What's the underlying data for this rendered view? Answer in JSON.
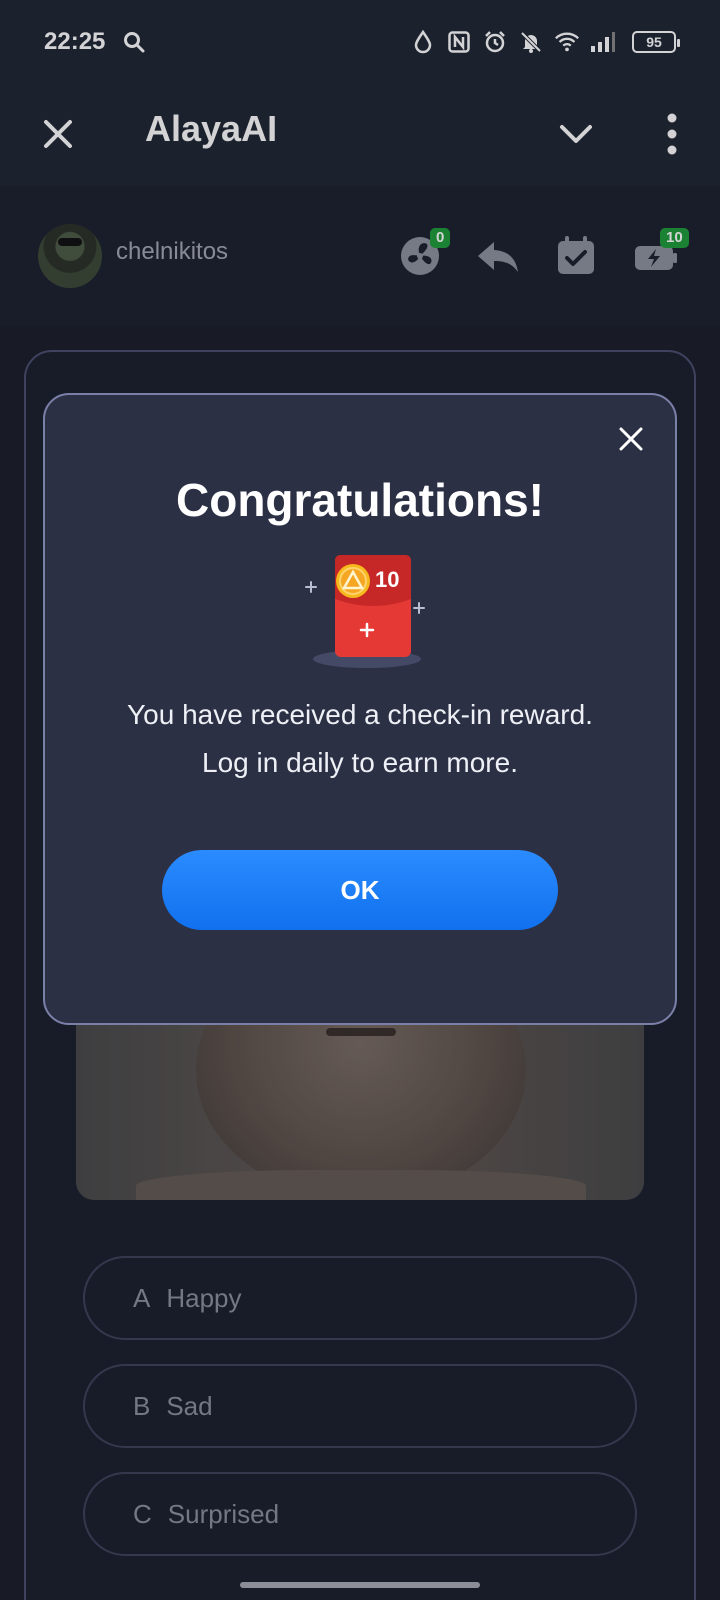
{
  "status_bar": {
    "time": "22:25",
    "battery": "95",
    "icons": [
      "search-icon",
      "water-drop-icon",
      "nfc-icon",
      "alarm-icon",
      "bell-off-icon",
      "wifi-icon",
      "signal-icon",
      "battery-icon"
    ]
  },
  "app_bar": {
    "title": "AlayaAI",
    "icons": [
      "close-icon",
      "chevron-down-icon",
      "more-vert-icon"
    ]
  },
  "user": {
    "name": "chelnikitos",
    "fan_badge": "0",
    "energy_badge": "10",
    "icons": [
      "fan-icon",
      "reply-icon",
      "calendar-check-icon",
      "battery-charging-icon"
    ]
  },
  "dialog": {
    "title": "Congratulations!",
    "reward_amount": "10",
    "message_line1": "You have received a check-in reward.",
    "message_line2": "Log in daily to earn more.",
    "ok_label": "OK"
  },
  "question": {
    "options": [
      {
        "letter": "A",
        "label": "Happy"
      },
      {
        "letter": "B",
        "label": "Sad"
      },
      {
        "letter": "C",
        "label": "Surprised"
      }
    ]
  },
  "colors": {
    "background": "#1b1e2a",
    "header": "#1f2733",
    "dialog": "#2b3045",
    "ok_button": "#1a7cff",
    "badge": "#1f9d3a",
    "reward_red": "#e53935"
  }
}
